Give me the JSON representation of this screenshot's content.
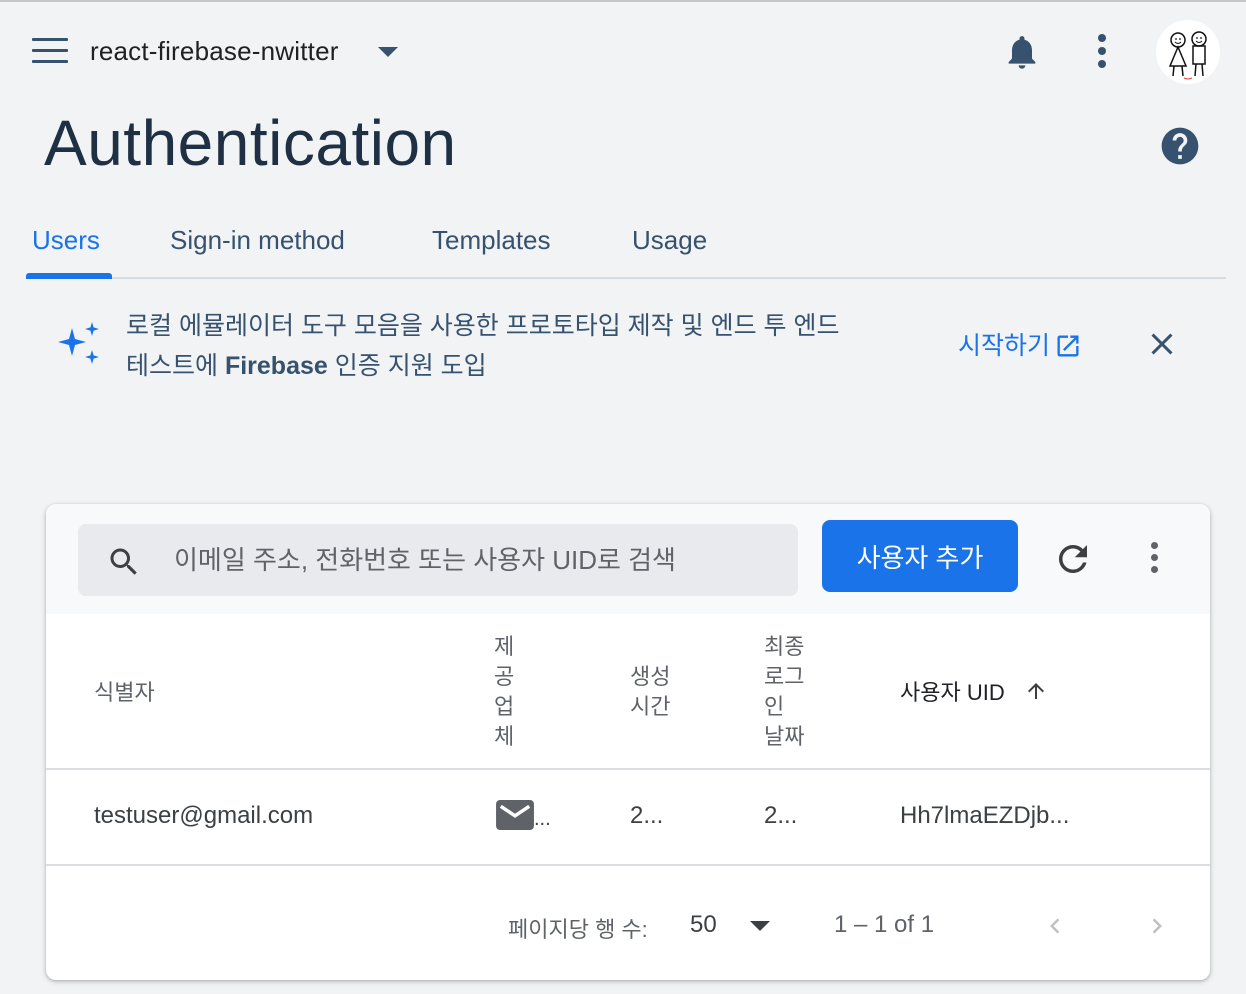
{
  "header": {
    "project_name": "react-firebase-nwitter",
    "menu_icon": "hamburger-menu-icon",
    "notifications_icon": "bell-icon",
    "more_icon": "more-vert-icon"
  },
  "page": {
    "title": "Authentication",
    "help_icon": "help-icon"
  },
  "tabs": [
    {
      "label": "Users",
      "active": true
    },
    {
      "label": "Sign-in method",
      "active": false
    },
    {
      "label": "Templates",
      "active": false
    },
    {
      "label": "Usage",
      "active": false
    }
  ],
  "banner": {
    "icon": "sparkle-icon",
    "line1": "로컬 에뮬레이터 도구 모음을 사용한 프로토타입 제작 및 엔드 투 엔드",
    "line2_prefix": "테스트에 ",
    "line2_bold": "Firebase",
    "line2_suffix": " 인증 지원 도입",
    "link_label": "시작하기",
    "close_icon": "close-icon"
  },
  "users_panel": {
    "search_placeholder": "이메일 주소, 전화번호 또는 사용자 UID로 검색",
    "add_user_label": "사용자 추가",
    "refresh_icon": "refresh-icon",
    "columns": {
      "identifier": "식별자",
      "provider": "제\n공\n업\n체",
      "created": "생성\n시간",
      "last_signin": "최종\n로그\n인\n날짜",
      "uid": "사용자 UID"
    },
    "sort": {
      "column": "사용자 UID",
      "direction": "ascending"
    },
    "rows": [
      {
        "identifier": "testuser@gmail.com",
        "provider_icon": "email-icon",
        "provider_ellipsis": "...",
        "created": "2...",
        "last_signin": "2...",
        "uid": "Hh7lmaEZDjb..."
      }
    ],
    "pagination": {
      "rows_per_page_label": "페이지당 행 수:",
      "rows_per_page": "50",
      "range": "1 – 1 of 1"
    }
  },
  "colors": {
    "accent": "#1a73e8",
    "title": "#1f3044",
    "nav": "#37526e",
    "background": "#f1f3f4"
  }
}
